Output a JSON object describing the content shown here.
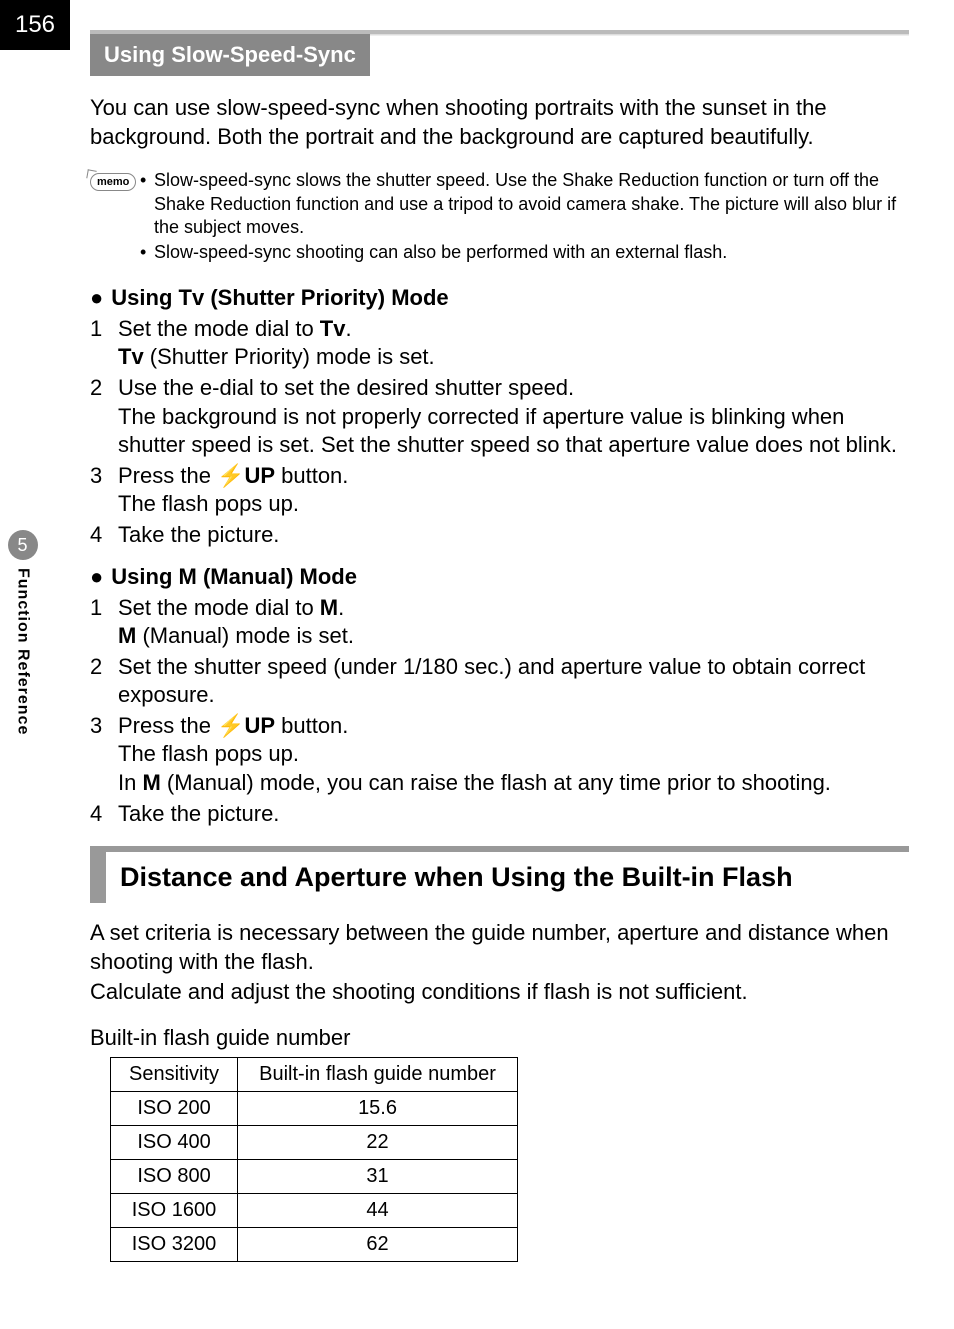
{
  "page_number": "156",
  "side_tab": {
    "number": "5",
    "label": "Function Reference"
  },
  "subsection_title": "Using Slow-Speed-Sync",
  "intro_para": "You can use slow-speed-sync when shooting portraits with the sunset in the background. Both the portrait and the background are captured beautifully.",
  "memo_label": "memo",
  "memo_items": [
    "Slow-speed-sync slows the shutter speed. Use the Shake Reduction function or turn off the Shake Reduction function and use a tripod to avoid camera shake. The picture will also blur if the subject moves.",
    "Slow-speed-sync shooting can also be performed with an external flash."
  ],
  "tv_heading_prefix": "Using ",
  "tv_sym": "Tv",
  "tv_heading_suffix": " (Shutter Priority) Mode",
  "tv_steps": [
    {
      "n": "1",
      "line1_a": "Set the mode dial to ",
      "line1_b": "Tv",
      "line1_c": ".",
      "line2_a": "Tv",
      "line2_b": " (Shutter Priority) mode is set."
    },
    {
      "n": "2",
      "line1": "Use the e-dial to set the desired shutter speed.",
      "line2": "The background is not properly corrected if aperture value is blinking when shutter speed is set. Set the shutter speed so that aperture value does not blink."
    },
    {
      "n": "3",
      "line1_a": "Press the ",
      "line1_b": "⚡UP",
      "line1_c": " button.",
      "line2": "The flash pops up."
    },
    {
      "n": "4",
      "line1": "Take the picture."
    }
  ],
  "m_heading_prefix": "Using ",
  "m_sym": "M",
  "m_heading_suffix": " (Manual) Mode",
  "m_steps": [
    {
      "n": "1",
      "line1_a": "Set the mode dial to ",
      "line1_b": "M",
      "line1_c": ".",
      "line2_a": "M",
      "line2_b": " (Manual) mode is set."
    },
    {
      "n": "2",
      "line1": "Set the shutter speed (under 1/180 sec.) and aperture value to obtain correct exposure."
    },
    {
      "n": "3",
      "line1_a": "Press the ",
      "line1_b": "⚡UP",
      "line1_c": " button.",
      "line2": "The flash pops up.",
      "line3_a": "In ",
      "line3_b": "M",
      "line3_c": " (Manual) mode, you can raise the flash at any time prior to shooting."
    },
    {
      "n": "4",
      "line1": "Take the picture."
    }
  ],
  "section_title": "Distance and Aperture when Using the Built-in Flash",
  "section_para1": "A set criteria is necessary between the guide number, aperture and distance when shooting with the flash.",
  "section_para2": "Calculate and adjust the shooting conditions if flash is not sufficient.",
  "table_caption": "Built-in flash guide number",
  "table_headers": {
    "col1": "Sensitivity",
    "col2": "Built-in flash guide number"
  },
  "table_rows": [
    {
      "c1": "ISO 200",
      "c2": "15.6"
    },
    {
      "c1": "ISO 400",
      "c2": "22"
    },
    {
      "c1": "ISO 800",
      "c2": "31"
    },
    {
      "c1": "ISO 1600",
      "c2": "44"
    },
    {
      "c1": "ISO 3200",
      "c2": "62"
    }
  ],
  "chart_data": {
    "type": "table",
    "title": "Built-in flash guide number",
    "columns": [
      "Sensitivity",
      "Built-in flash guide number"
    ],
    "rows": [
      [
        "ISO 200",
        15.6
      ],
      [
        "ISO 400",
        22
      ],
      [
        "ISO 800",
        31
      ],
      [
        "ISO 1600",
        44
      ],
      [
        "ISO 3200",
        62
      ]
    ]
  }
}
